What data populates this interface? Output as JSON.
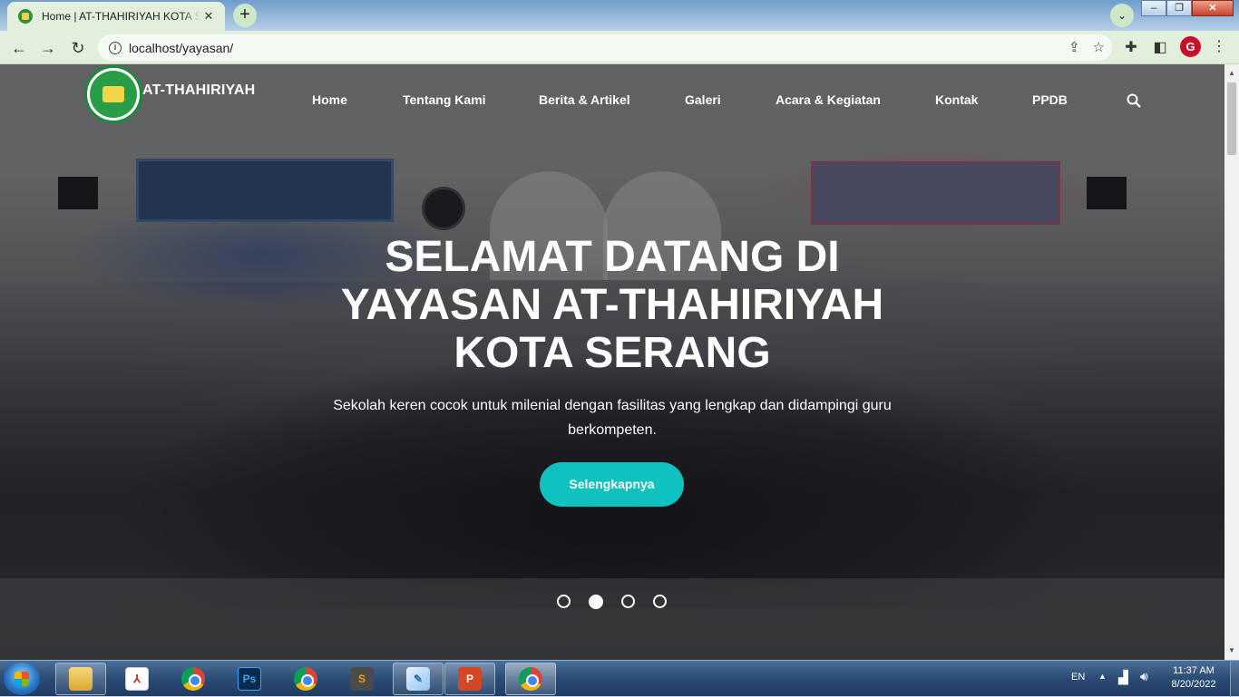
{
  "browser": {
    "tab_title": "Home | AT-THAHIRIYAH KOTA SERANG",
    "url": "localhost/yayasan/"
  },
  "site": {
    "name": "AT-THAHIRIYAH",
    "nav": [
      "Home",
      "Tentang Kami",
      "Berita & Artikel",
      "Galeri",
      "Acara & Kegiatan",
      "Kontak",
      "PPDB"
    ]
  },
  "hero": {
    "title_lines": [
      "SELAMAT DATANG DI",
      "YAYASAN AT-THAHIRIYAH",
      "KOTA SERANG"
    ],
    "subtitle": "Sekolah keren cocok untuk milenial dengan fasilitas yang lengkap dan didampingi guru berkompeten.",
    "cta_label": "Selengkapnya",
    "slides": 4,
    "active_slide": 2,
    "cta_color": "#0fc2c0"
  },
  "taskbar": {
    "apps": [
      "file-explorer",
      "adobe-acrobat",
      "chrome-canary",
      "photoshop",
      "chrome",
      "sublime-text",
      "notepad-pen",
      "powerpoint",
      "chrome-active"
    ],
    "language": "EN",
    "time": "11:37 AM",
    "date": "8/20/2022"
  }
}
